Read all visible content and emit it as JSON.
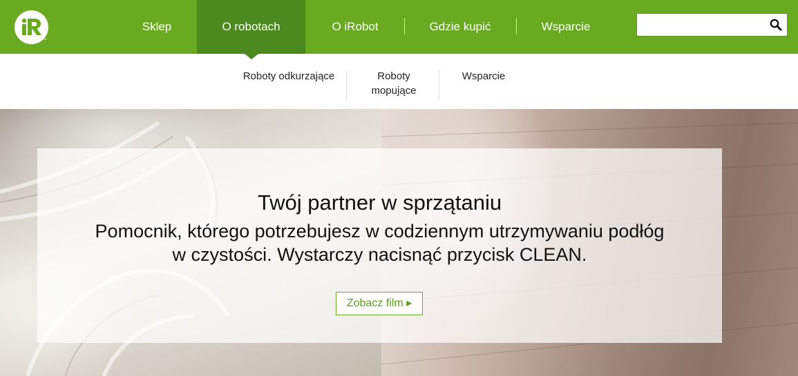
{
  "header": {
    "logo": {
      "icon": "irobot-logo-icon",
      "text": "iR",
      "trademark": "™"
    },
    "nav": [
      {
        "label": "Sklep",
        "active": false
      },
      {
        "label": "O robotach",
        "active": true
      },
      {
        "label": "O iRobot",
        "active": false
      },
      {
        "label": "Gdzie kupić",
        "active": false
      },
      {
        "label": "Wsparcie",
        "active": false
      }
    ],
    "search": {
      "value": "",
      "placeholder": "",
      "icon": "search-icon"
    }
  },
  "subnav": {
    "items": [
      {
        "label": "Roboty odkurzające"
      },
      {
        "label_line1": "Roboty",
        "label_line2": "mopujące"
      },
      {
        "label": "Wsparcie"
      }
    ]
  },
  "hero": {
    "title": "Twój partner w sprzątaniu",
    "subtitle_line1": "Pomocnik, którego potrzebujesz w codziennym utrzymywaniu podłóg",
    "subtitle_line2": "w czystości. Wystarczy nacisnąć przycisk CLEAN.",
    "cta_label": "Zobacz film ▸"
  },
  "colors": {
    "brand_green": "#6aaa21",
    "active_nav": "#4c8a1f",
    "cta_text": "#5a9e1c"
  }
}
